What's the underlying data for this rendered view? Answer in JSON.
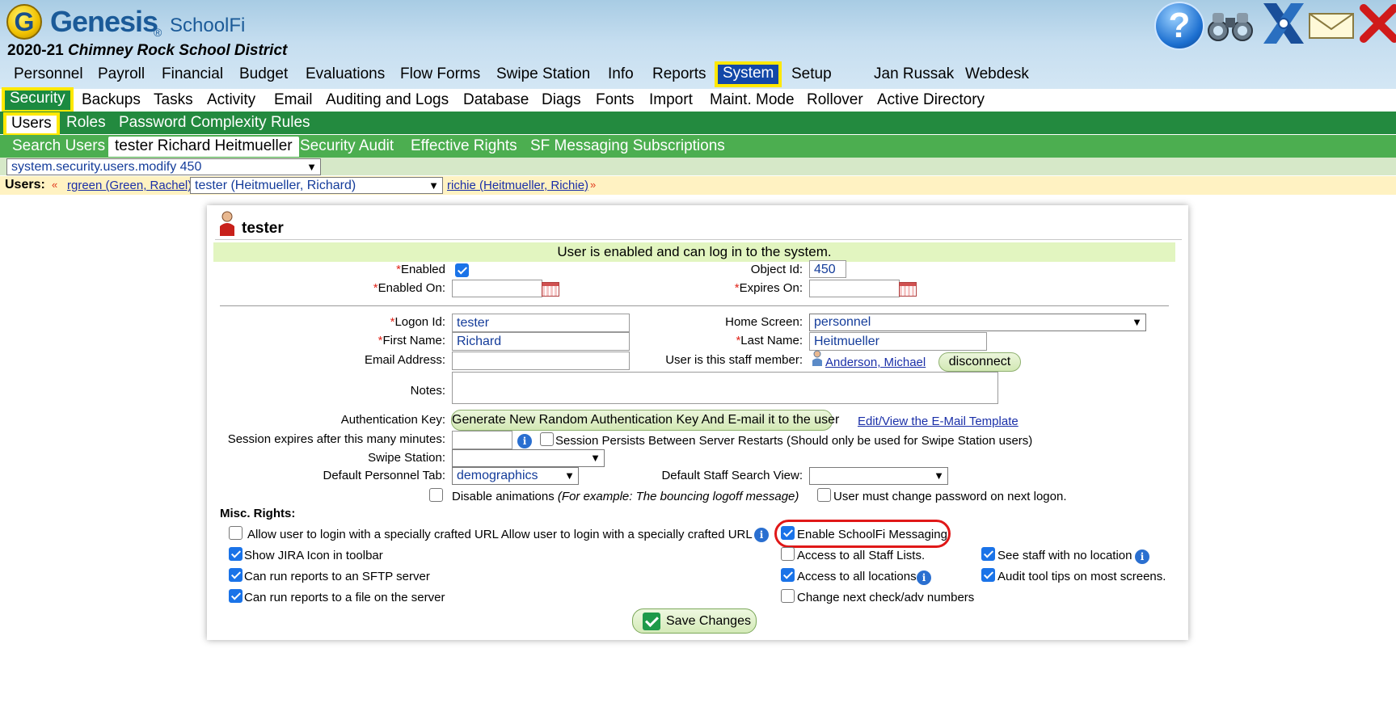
{
  "app": {
    "logo_letter": "G",
    "brand": "Genesis",
    "brand_reg": "®",
    "brand_sub": "SchoolFi",
    "district_year": "2020-21",
    "district_name": "Chimney Rock School District"
  },
  "main_nav": [
    "Personnel",
    "Payroll",
    "Financial",
    "Budget",
    "Evaluations",
    "Flow Forms",
    "Swipe Station",
    "Info",
    "Reports",
    "System",
    "Setup",
    "Jan Russak",
    "Webdesk"
  ],
  "sub_nav": [
    "Security",
    "Backups",
    "Tasks",
    "Activity",
    "Email",
    "Auditing and Logs",
    "Database",
    "Diags",
    "Fonts",
    "Import",
    "Maint. Mode",
    "Rollover",
    "Active Directory"
  ],
  "tabs_level1": [
    "Users",
    "Roles",
    "Password Complexity Rules"
  ],
  "tabs_level2": [
    "Search Users",
    "tester Richard Heitmueller",
    "Security Audit",
    "Effective Rights",
    "SF Messaging Subscriptions"
  ],
  "path_select": "system.security.users.modify 450",
  "users_bar": {
    "label": "Users:",
    "prev_arrow": "«",
    "prev_user": "rgreen (Green, Rachel)",
    "current_user": "tester (Heitmueller, Richard)",
    "next_user": "richie (Heitmueller, Richie)",
    "next_arrow": "»"
  },
  "form": {
    "title": "tester",
    "status": "User is enabled and can log in to the system.",
    "required_mark": "*",
    "enabled_label": "Enabled",
    "enabled": true,
    "enabled_on_label": "Enabled On:",
    "enabled_on_value": "",
    "object_id_label": "Object Id:",
    "object_id_value": "450",
    "expires_on_label": "Expires On:",
    "expires_on_value": "",
    "logon_id_label": "Logon Id:",
    "logon_id_value": "tester",
    "home_screen_label": "Home Screen:",
    "home_screen_value": "personnel",
    "first_name_label": "First Name:",
    "first_name_value": "Richard",
    "last_name_label": "Last Name:",
    "last_name_value": "Heitmueller",
    "email_label": "Email Address:",
    "email_value": "",
    "staff_member_label": "User is this staff member:",
    "staff_member_link": "Anderson, Michael",
    "disconnect_label": "disconnect",
    "notes_label": "Notes:",
    "notes_value": "",
    "auth_key_label": "Authentication Key:",
    "auth_key_button": "Generate New Random Authentication Key And E-mail it to the user",
    "email_template_link": "Edit/View the E-Mail Template",
    "session_label": "Session expires after this many minutes:",
    "session_value": "",
    "session_persists_label": "Session Persists Between Server Restarts (Should only be used for Swipe Station users)",
    "swipe_station_label": "Swipe Station:",
    "swipe_station_value": "",
    "default_tab_label": "Default Personnel Tab:",
    "default_tab_value": "demographics",
    "default_staff_view_label": "Default Staff Search View:",
    "default_staff_view_value": "",
    "disable_anim_label": "Disable animations",
    "disable_anim_example": "(For example: The bouncing logoff message)",
    "must_change_pw_label": "User must change password on next logon.",
    "misc_rights_label": "Misc. Rights:",
    "rights": [
      {
        "label": "Allow user to login with a specially crafted URL Allow user to login with a specially crafted URL",
        "checked": false
      },
      {
        "label": "Enable SchoolFi Messaging",
        "checked": true
      },
      {
        "label": "Show JIRA Icon in toolbar",
        "checked": true
      },
      {
        "label": "Access to all Staff Lists.",
        "checked": false
      },
      {
        "label": "See staff with no location",
        "checked": true
      },
      {
        "label": "Can run reports to an SFTP server",
        "checked": true
      },
      {
        "label": "Access to all locations",
        "checked": true
      },
      {
        "label": "Audit tool tips on most screens.",
        "checked": true
      },
      {
        "label": "Can run reports to a file on the server",
        "checked": true
      },
      {
        "label": "Change next check/adv numbers",
        "checked": false
      }
    ],
    "save_label": "Save Changes"
  },
  "colors": {
    "system_tab_bg": "#1348a8",
    "highlight_yellow": "#ffe800",
    "tab_bar_dark": "#238a3f",
    "tab_bar_light": "#4cae50",
    "status_band": "#e2f5c0",
    "highlight_ring": "#e01818"
  }
}
